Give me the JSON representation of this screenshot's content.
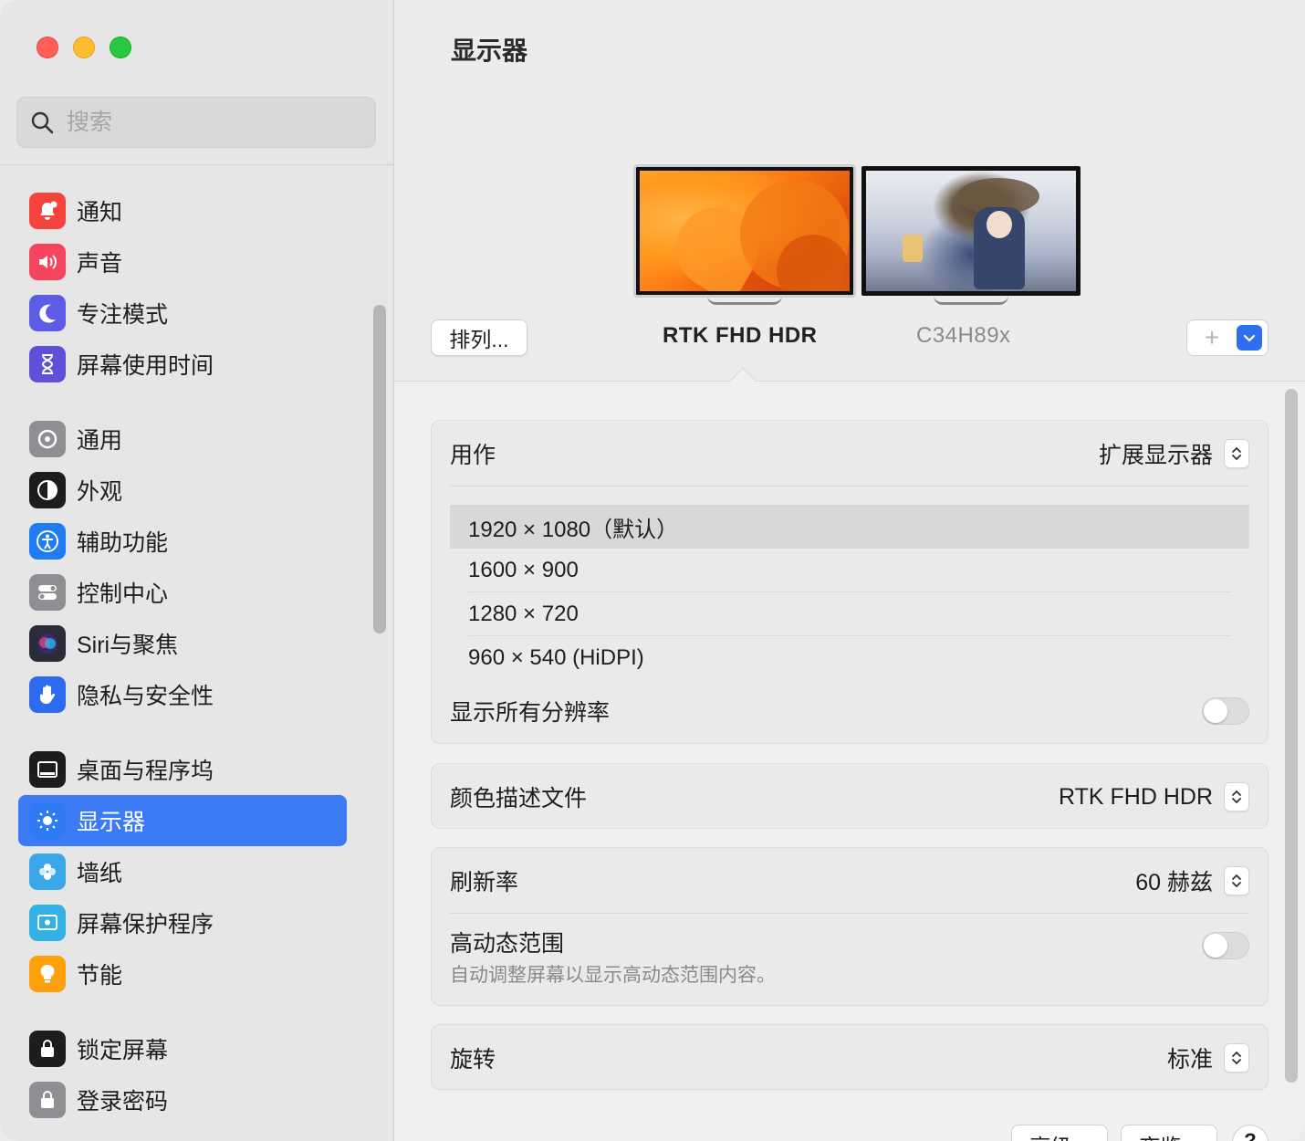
{
  "search": {
    "placeholder": "搜索"
  },
  "sidebar": {
    "groups": [
      [
        {
          "label": "通知",
          "icon": "bell-icon",
          "color": "#f5443c"
        },
        {
          "label": "声音",
          "icon": "speaker-icon",
          "color": "#f5445e"
        },
        {
          "label": "专注模式",
          "icon": "moon-icon",
          "color": "#5e5ce6"
        },
        {
          "label": "屏幕使用时间",
          "icon": "hourglass-icon",
          "color": "#5e50d8"
        }
      ],
      [
        {
          "label": "通用",
          "icon": "gear-icon",
          "color": "#8e8e93"
        },
        {
          "label": "外观",
          "icon": "appearance-icon",
          "color": "#1d1d1f"
        },
        {
          "label": "辅助功能",
          "icon": "accessibility-icon",
          "color": "#1e7cf5"
        },
        {
          "label": "控制中心",
          "icon": "control-center-icon",
          "color": "#8e8e93"
        },
        {
          "label": "Siri与聚焦",
          "icon": "siri-icon",
          "color": "#2b2b3a"
        },
        {
          "label": "隐私与安全性",
          "icon": "hand-icon",
          "color": "#2d6cf0"
        }
      ],
      [
        {
          "label": "桌面与程序坞",
          "icon": "dock-icon",
          "color": "#1d1d1f"
        },
        {
          "label": "显示器",
          "icon": "brightness-icon",
          "color": "#2f7bf5",
          "active": true
        },
        {
          "label": "墙纸",
          "icon": "wallpaper-icon",
          "color": "#3aa7e8"
        },
        {
          "label": "屏幕保护程序",
          "icon": "screensaver-icon",
          "color": "#33b0e6"
        },
        {
          "label": "节能",
          "icon": "bulb-icon",
          "color": "#ff9f0a"
        }
      ],
      [
        {
          "label": "锁定屏幕",
          "icon": "lock-screen-icon",
          "color": "#1d1d1f"
        },
        {
          "label": "登录密码",
          "icon": "lock-icon",
          "color": "#8e8e93"
        }
      ]
    ]
  },
  "main": {
    "title": "显示器",
    "arrange_label": "排列...",
    "monitors": [
      {
        "name": "RTK FHD HDR",
        "selected": true
      },
      {
        "name": "C34H89x",
        "selected": false
      }
    ],
    "add_label": "+",
    "use_as": {
      "label": "用作",
      "value": "扩展显示器"
    },
    "resolutions": [
      {
        "label": "1920 × 1080（默认）",
        "selected": true
      },
      {
        "label": "1600 × 900",
        "selected": false
      },
      {
        "label": "1280 × 720",
        "selected": false
      },
      {
        "label": "960 × 540 (HiDPI)",
        "selected": false
      }
    ],
    "show_all_label": "显示所有分辨率",
    "color_profile": {
      "label": "颜色描述文件",
      "value": "RTK FHD HDR"
    },
    "refresh_rate": {
      "label": "刷新率",
      "value": "60 赫兹"
    },
    "hdr": {
      "label": "高动态范围",
      "description": "自动调整屏幕以显示高动态范围内容。"
    },
    "rotation": {
      "label": "旋转",
      "value": "标准"
    },
    "advanced_label": "高级...",
    "night_shift_label": "夜览...",
    "help_label": "?"
  }
}
